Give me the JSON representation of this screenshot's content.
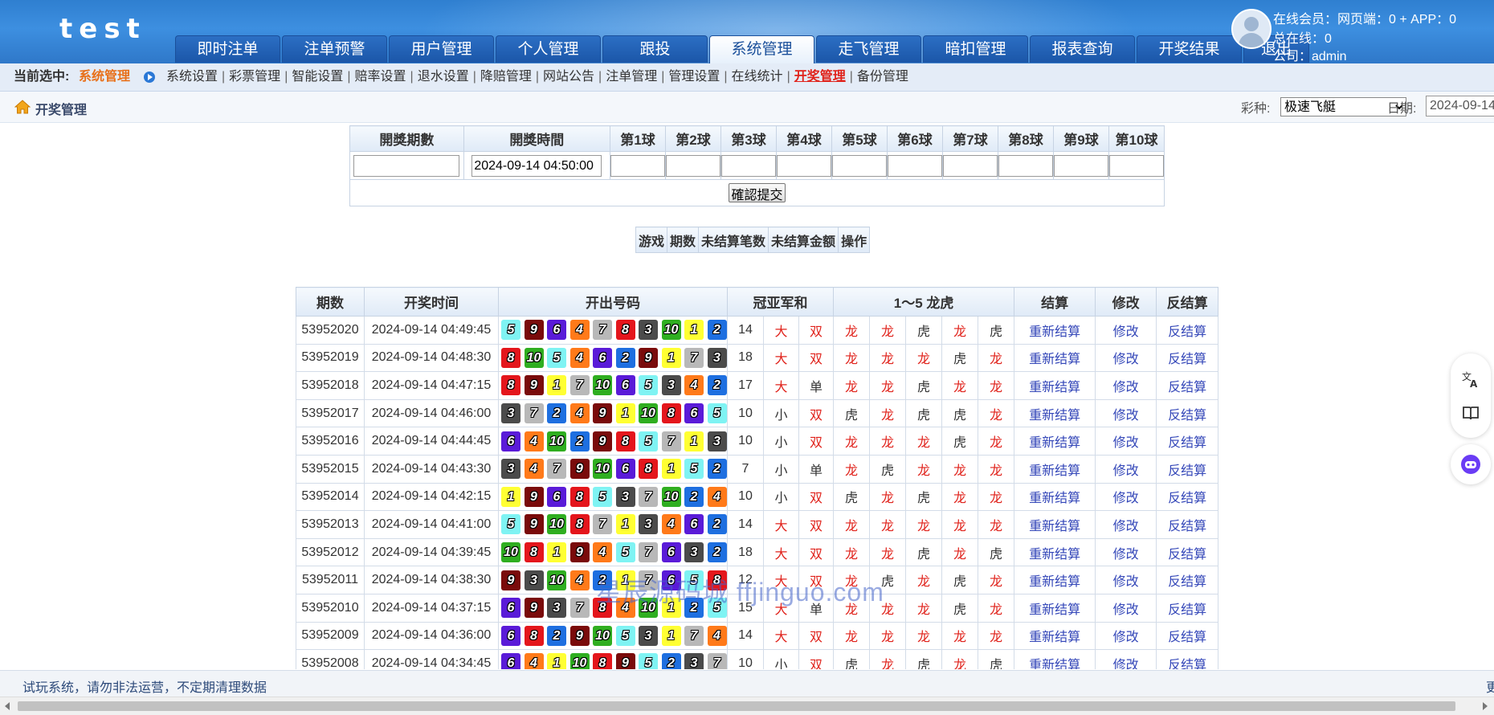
{
  "header": {
    "logo": "test",
    "nav_tabs": [
      "即时注单",
      "注单预警",
      "用户管理",
      "个人管理",
      "跟投",
      "系统管理",
      "走飞管理",
      "暗扣管理",
      "报表查询",
      "开奖结果",
      "退出"
    ],
    "active_tab": "系统管理",
    "user": {
      "online_members": "在线会员：网页端：0 + APP：0",
      "total_online": "总在线：0",
      "company": "公司：admin"
    }
  },
  "subnav": {
    "current_label": "当前选中:",
    "current_value": "系统管理",
    "links": [
      "系统设置",
      "彩票管理",
      "智能设置",
      "赔率设置",
      "退水设置",
      "降赔管理",
      "网站公告",
      "注单管理",
      "管理设置",
      "在线统计",
      "开奖管理",
      "备份管理"
    ],
    "active_link": "开奖管理"
  },
  "titlebar": {
    "title": "开奖管理",
    "lottery_label": "彩种:",
    "lottery_selected": "极速飞艇",
    "date_label": "日期:",
    "date_value": "2024-09-14"
  },
  "entry_form": {
    "headers": [
      "開獎期數",
      "開獎時間",
      "第1球",
      "第2球",
      "第3球",
      "第4球",
      "第5球",
      "第6球",
      "第7球",
      "第8球",
      "第9球",
      "第10球"
    ],
    "issue_value": "",
    "time_value": "2024-09-14 04:50:00",
    "submit_label": "確認提交"
  },
  "pending_table": {
    "headers": [
      "游戏",
      "期数",
      "未结算笔数",
      "未结算金额",
      "操作"
    ]
  },
  "results": {
    "headers": [
      "期数",
      "开奖时间",
      "开出号码",
      "冠亚军和",
      "1～5 龙虎",
      "结算",
      "修改",
      "反结算"
    ],
    "action_labels": {
      "settle": "重新结算",
      "edit": "修改",
      "unsettle": "反结算"
    },
    "ball_colors": {
      "1": "#ffff33",
      "2": "#1e6fe0",
      "3": "#4b4b4b",
      "4": "#ff7a1a",
      "5": "#7ff3f3",
      "6": "#5a1bd8",
      "7": "#b8b8b8",
      "8": "#e4161c",
      "9": "#7a0b0b",
      "10": "#2fae20"
    },
    "rows": [
      {
        "issue": "53952020",
        "time": "2024-09-14 04:49:45",
        "balls": [
          5,
          9,
          6,
          4,
          7,
          8,
          3,
          10,
          1,
          2
        ],
        "sum": "14",
        "size": "大",
        "parity": "双",
        "dt": [
          "龙",
          "龙",
          "虎",
          "龙",
          "虎"
        ]
      },
      {
        "issue": "53952019",
        "time": "2024-09-14 04:48:30",
        "balls": [
          8,
          10,
          5,
          4,
          6,
          2,
          9,
          1,
          7,
          3
        ],
        "sum": "18",
        "size": "大",
        "parity": "双",
        "dt": [
          "龙",
          "龙",
          "龙",
          "虎",
          "龙"
        ]
      },
      {
        "issue": "53952018",
        "time": "2024-09-14 04:47:15",
        "balls": [
          8,
          9,
          1,
          7,
          10,
          6,
          5,
          3,
          4,
          2
        ],
        "sum": "17",
        "size": "大",
        "parity": "单",
        "dt": [
          "龙",
          "龙",
          "虎",
          "龙",
          "龙"
        ]
      },
      {
        "issue": "53952017",
        "time": "2024-09-14 04:46:00",
        "balls": [
          3,
          7,
          2,
          4,
          9,
          1,
          10,
          8,
          6,
          5
        ],
        "sum": "10",
        "size": "小",
        "parity": "双",
        "dt": [
          "虎",
          "龙",
          "虎",
          "虎",
          "龙"
        ]
      },
      {
        "issue": "53952016",
        "time": "2024-09-14 04:44:45",
        "balls": [
          6,
          4,
          10,
          2,
          9,
          8,
          5,
          7,
          1,
          3
        ],
        "sum": "10",
        "size": "小",
        "parity": "双",
        "dt": [
          "龙",
          "龙",
          "龙",
          "虎",
          "龙"
        ]
      },
      {
        "issue": "53952015",
        "time": "2024-09-14 04:43:30",
        "balls": [
          3,
          4,
          7,
          9,
          10,
          6,
          8,
          1,
          5,
          2
        ],
        "sum": "7",
        "size": "小",
        "parity": "单",
        "dt": [
          "龙",
          "虎",
          "龙",
          "龙",
          "龙"
        ]
      },
      {
        "issue": "53952014",
        "time": "2024-09-14 04:42:15",
        "balls": [
          1,
          9,
          6,
          8,
          5,
          3,
          7,
          10,
          2,
          4
        ],
        "sum": "10",
        "size": "小",
        "parity": "双",
        "dt": [
          "虎",
          "龙",
          "虎",
          "龙",
          "龙"
        ]
      },
      {
        "issue": "53952013",
        "time": "2024-09-14 04:41:00",
        "balls": [
          5,
          9,
          10,
          8,
          7,
          1,
          3,
          4,
          6,
          2
        ],
        "sum": "14",
        "size": "大",
        "parity": "双",
        "dt": [
          "龙",
          "龙",
          "龙",
          "龙",
          "龙"
        ]
      },
      {
        "issue": "53952012",
        "time": "2024-09-14 04:39:45",
        "balls": [
          10,
          8,
          1,
          9,
          4,
          5,
          7,
          6,
          3,
          2
        ],
        "sum": "18",
        "size": "大",
        "parity": "双",
        "dt": [
          "龙",
          "龙",
          "虎",
          "龙",
          "虎"
        ]
      },
      {
        "issue": "53952011",
        "time": "2024-09-14 04:38:30",
        "balls": [
          9,
          3,
          10,
          4,
          2,
          1,
          7,
          6,
          5,
          8
        ],
        "sum": "12",
        "size": "大",
        "parity": "双",
        "dt": [
          "龙",
          "虎",
          "龙",
          "虎",
          "龙"
        ]
      },
      {
        "issue": "53952010",
        "time": "2024-09-14 04:37:15",
        "balls": [
          6,
          9,
          3,
          7,
          8,
          4,
          10,
          1,
          2,
          5
        ],
        "sum": "15",
        "size": "大",
        "parity": "单",
        "dt": [
          "龙",
          "龙",
          "龙",
          "虎",
          "龙"
        ]
      },
      {
        "issue": "53952009",
        "time": "2024-09-14 04:36:00",
        "balls": [
          6,
          8,
          2,
          9,
          10,
          5,
          3,
          1,
          7,
          4
        ],
        "sum": "14",
        "size": "大",
        "parity": "双",
        "dt": [
          "龙",
          "龙",
          "龙",
          "龙",
          "龙"
        ]
      },
      {
        "issue": "53952008",
        "time": "2024-09-14 04:34:45",
        "balls": [
          6,
          4,
          1,
          10,
          8,
          9,
          5,
          2,
          3,
          7
        ],
        "sum": "10",
        "size": "小",
        "parity": "双",
        "dt": [
          "虎",
          "龙",
          "虎",
          "龙",
          "虎"
        ]
      }
    ]
  },
  "footer": {
    "notice": "试玩系统，请勿非法运营，不定期清理数据",
    "right_text": "更"
  },
  "watermark": "星辰源码城  ffjinguo.com"
}
